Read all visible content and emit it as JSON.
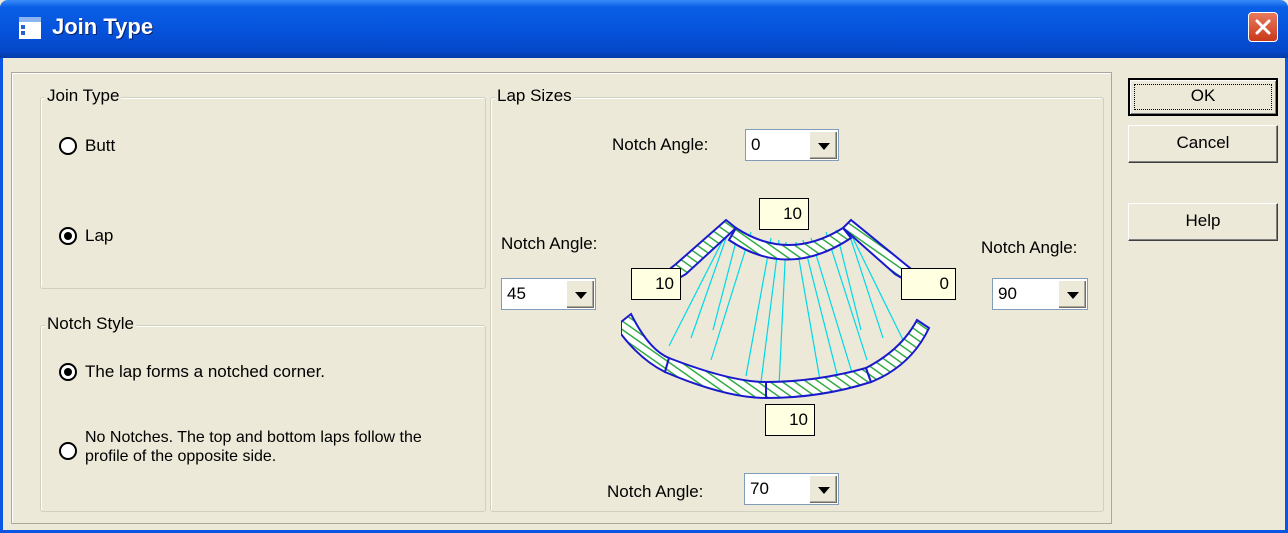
{
  "window": {
    "title": "Join Type",
    "app_icon": "window-app-icon",
    "close_icon": "close-icon"
  },
  "join_type_group": {
    "legend": "Join Type",
    "options": [
      {
        "label": "Butt",
        "selected": false
      },
      {
        "label": "Lap",
        "selected": true
      }
    ]
  },
  "notch_style_group": {
    "legend": "Notch Style",
    "options": [
      {
        "label": "The lap forms a notched corner.",
        "selected": true
      },
      {
        "label": "No Notches. The top and bottom laps follow the profile of the opposite side.",
        "selected": false
      }
    ]
  },
  "lap_sizes_group": {
    "legend": "Lap Sizes",
    "top": {
      "notch_label": "Notch Angle:",
      "notch_value": "0",
      "lap_size": "10"
    },
    "left": {
      "notch_label": "Notch Angle:",
      "notch_value": "45",
      "lap_size": "10"
    },
    "right": {
      "notch_label": "Notch Angle:",
      "notch_value": "90",
      "lap_size": "0"
    },
    "bottom": {
      "notch_label": "Notch Angle:",
      "notch_value": "70",
      "lap_size": "10"
    }
  },
  "buttons": {
    "ok": "OK",
    "cancel": "Cancel",
    "help": "Help"
  },
  "colors": {
    "titlebar": "#0553d8",
    "hatch": "#33aa44",
    "outline": "#1a1acc",
    "rays": "#00d8e8",
    "lap_box": "#ffffe1"
  }
}
